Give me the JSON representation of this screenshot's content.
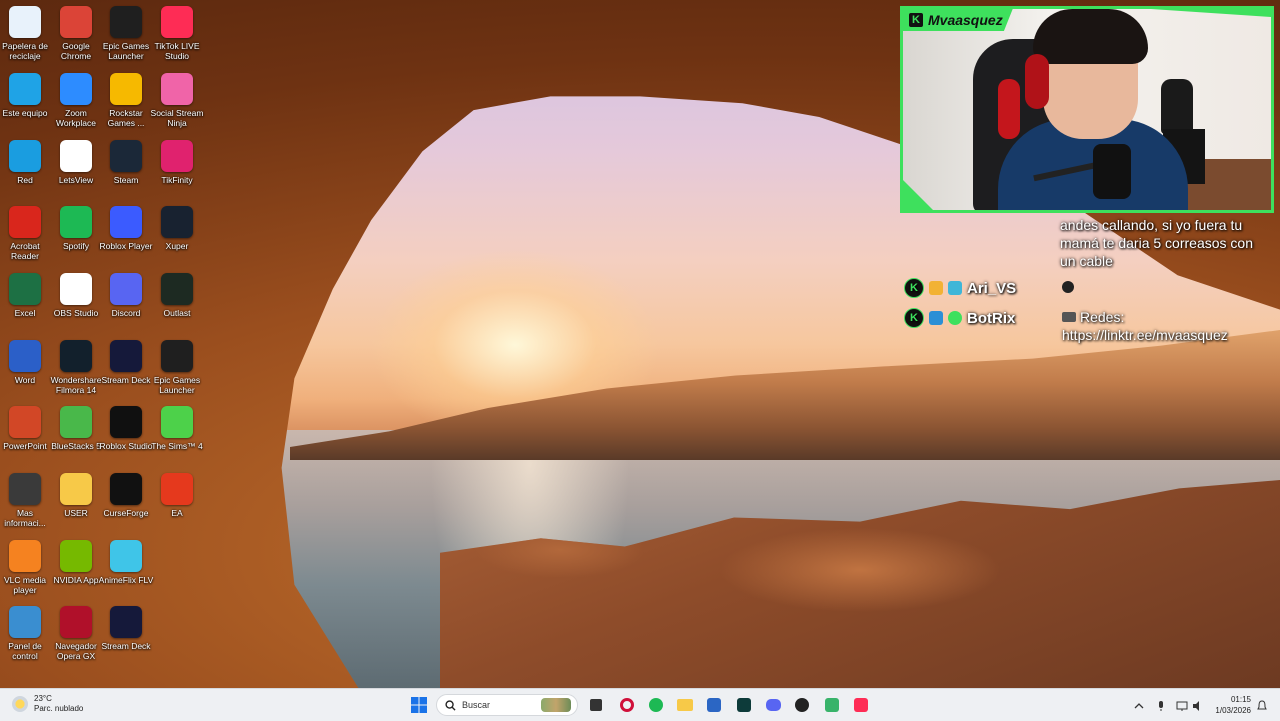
{
  "desktop": {
    "icons": [
      {
        "label": "Papelera de reciclaje",
        "icon": "recycle-bin-icon",
        "color": "#e8f2fb"
      },
      {
        "label": "Google Chrome",
        "icon": "chrome-icon",
        "color": "#db4437"
      },
      {
        "label": "Epic Games Launcher",
        "icon": "epic-games-icon",
        "color": "#1f1f1f"
      },
      {
        "label": "TikTok LIVE Studio",
        "icon": "tiktok-icon",
        "color": "#fe2c55"
      },
      {
        "label": "Este equipo",
        "icon": "computer-icon",
        "color": "#1fa3e6"
      },
      {
        "label": "Zoom Workplace",
        "icon": "zoom-icon",
        "color": "#2d8cff"
      },
      {
        "label": "Rockstar Games ...",
        "icon": "rockstar-icon",
        "color": "#f6b900"
      },
      {
        "label": "Social Stream Ninja",
        "icon": "ninja-icon",
        "color": "#f064a8"
      },
      {
        "label": "Red",
        "icon": "network-icon",
        "color": "#1a9de0"
      },
      {
        "label": "LetsView",
        "icon": "letsview-icon",
        "color": "#ffffff"
      },
      {
        "label": "Steam",
        "icon": "steam-icon",
        "color": "#1b2838"
      },
      {
        "label": "TikFinity",
        "icon": "tikfinity-icon",
        "color": "#e0226e"
      },
      {
        "label": "Acrobat Reader",
        "icon": "acrobat-icon",
        "color": "#d9261c"
      },
      {
        "label": "Spotify",
        "icon": "spotify-icon",
        "color": "#1db954"
      },
      {
        "label": "Roblox Player",
        "icon": "roblox-icon",
        "color": "#3b5bff"
      },
      {
        "label": "Xuper",
        "icon": "xuper-icon",
        "color": "#182230"
      },
      {
        "label": "Excel",
        "icon": "excel-icon",
        "color": "#1d7044"
      },
      {
        "label": "OBS Studio",
        "icon": "obs-file-icon",
        "color": "#ffffff"
      },
      {
        "label": "Discord",
        "icon": "discord-icon",
        "color": "#5865f2"
      },
      {
        "label": "Outlast",
        "icon": "outlast-icon",
        "color": "#1d2a22"
      },
      {
        "label": "Word",
        "icon": "word-icon",
        "color": "#2b5fc8"
      },
      {
        "label": "Wondershare Filmora 14",
        "icon": "filmora-icon",
        "color": "#12202c"
      },
      {
        "label": "Stream Deck",
        "icon": "stream-deck-icon",
        "color": "#15193a"
      },
      {
        "label": "Epic Games Launcher",
        "icon": "epic-games-icon",
        "color": "#1f1f1f"
      },
      {
        "label": "PowerPoint",
        "icon": "powerpoint-icon",
        "color": "#d24726"
      },
      {
        "label": "BlueStacks 5",
        "icon": "bluestacks-icon",
        "color": "#49b84a"
      },
      {
        "label": "Roblox Studio",
        "icon": "roblox-studio-icon",
        "color": "#101010"
      },
      {
        "label": "The Sims™ 4",
        "icon": "sims-icon",
        "color": "#4dd14a"
      },
      {
        "label": "Mas informaci...",
        "icon": "info-icon",
        "color": "#3a3a3a"
      },
      {
        "label": "USER",
        "icon": "folder-icon",
        "color": "#f7c948"
      },
      {
        "label": "CurseForge",
        "icon": "curseforge-icon",
        "color": "#111111"
      },
      {
        "label": "EA",
        "icon": "ea-icon",
        "color": "#e5391d"
      },
      {
        "label": "VLC media player",
        "icon": "vlc-icon",
        "color": "#f58220"
      },
      {
        "label": "NVIDIA App",
        "icon": "nvidia-icon",
        "color": "#76b900"
      },
      {
        "label": "AnimeFlix FLV",
        "icon": "animeflix-icon",
        "color": "#3fc5e8"
      },
      {
        "label": "",
        "icon": "",
        "color": ""
      },
      {
        "label": "Panel de control",
        "icon": "control-panel-icon",
        "color": "#3a8ed0"
      },
      {
        "label": "Navegador Opera GX",
        "icon": "opera-gx-icon",
        "color": "#b0102a"
      },
      {
        "label": "Stream Deck",
        "icon": "stream-deck-icon",
        "color": "#15193a"
      }
    ]
  },
  "stream": {
    "name_tag": "Mvaasquez",
    "chat_message": "andes callando, si yo fuera tu mamá te daria 5 correasos con un cable",
    "chat_users": [
      {
        "name": "Ari_VS"
      },
      {
        "name": "BotRix"
      }
    ],
    "socials_label": "Redes:",
    "socials_link": "https://linktr.ee/mvaasquez"
  },
  "taskbar": {
    "weather_temp": "23°C",
    "weather_desc": "Parc. nublado",
    "search_placeholder": "Buscar",
    "time": "01:15",
    "date": "1/03/2026"
  },
  "colors": {
    "accent": "#3ee05d",
    "taskbar": "#eef0f3"
  }
}
